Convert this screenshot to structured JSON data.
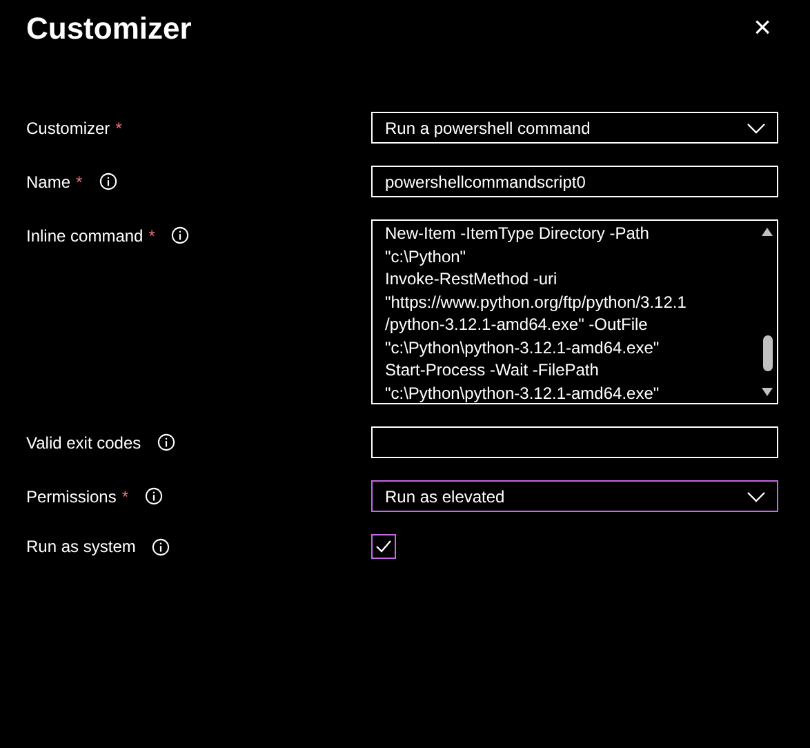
{
  "panel": {
    "title": "Customizer",
    "close": "×"
  },
  "fields": [
    {
      "kind": "select",
      "label": "Customizer",
      "required_mark": "*",
      "info": false,
      "value": "Run a powershell command",
      "focused": false
    },
    {
      "kind": "text",
      "label": "Name",
      "required_mark": "*",
      "info": true,
      "value": "powershellcommandscript0",
      "focused": false
    },
    {
      "kind": "textarea",
      "label": "Inline command",
      "required_mark": "*",
      "info": true,
      "lines": [
        "New-Item -ItemType Directory -Path",
        "\"c:\\Python\"",
        "Invoke-RestMethod -uri",
        "\"https://www.python.org/ftp/python/3.12.1",
        "/python-3.12.1-amd64.exe\" -OutFile",
        "\"c:\\Python\\python-3.12.1-amd64.exe\"",
        "Start-Process -Wait -FilePath",
        "\"c:\\Python\\python-3.12.1-amd64.exe\""
      ],
      "focused": false
    },
    {
      "kind": "text",
      "label": "Valid exit codes",
      "info": true,
      "focused": false
    },
    {
      "kind": "select",
      "label": "Permissions",
      "required_mark": "*",
      "info": true,
      "value": "Run as elevated",
      "focused": true
    },
    {
      "kind": "checkbox",
      "label": "Run as system",
      "info": true,
      "checked": true,
      "focused": true
    }
  ]
}
